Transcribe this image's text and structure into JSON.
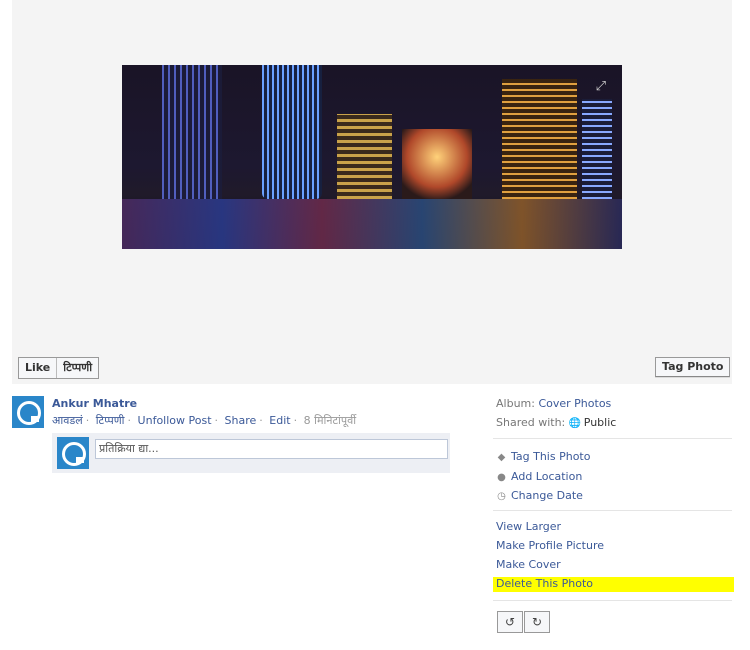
{
  "photo": {
    "expand_icon": "expand-icon"
  },
  "buttons": {
    "like": "Like",
    "comment": "टिप्पणी",
    "tag_photo": "Tag Photo"
  },
  "post": {
    "author": "Ankur Mhatre",
    "actions": [
      "आवडलं",
      "टिप्पणी",
      "Unfollow Post",
      "Share",
      "Edit"
    ],
    "time": "8 मिनिटांपूर्वी",
    "comment_placeholder": "प्रतिक्रिया द्या..."
  },
  "sidebar": {
    "album_label": "Album:",
    "album_value": "Cover Photos",
    "shared_label": "Shared with:",
    "shared_value": "Public",
    "tag": "Tag This Photo",
    "location": "Add Location",
    "date": "Change Date",
    "view_larger": "View Larger",
    "make_profile": "Make Profile Picture",
    "make_cover": "Make Cover",
    "delete": "Delete This Photo"
  },
  "colors": {
    "link": "#3b5998",
    "highlight": "#ffff00"
  }
}
